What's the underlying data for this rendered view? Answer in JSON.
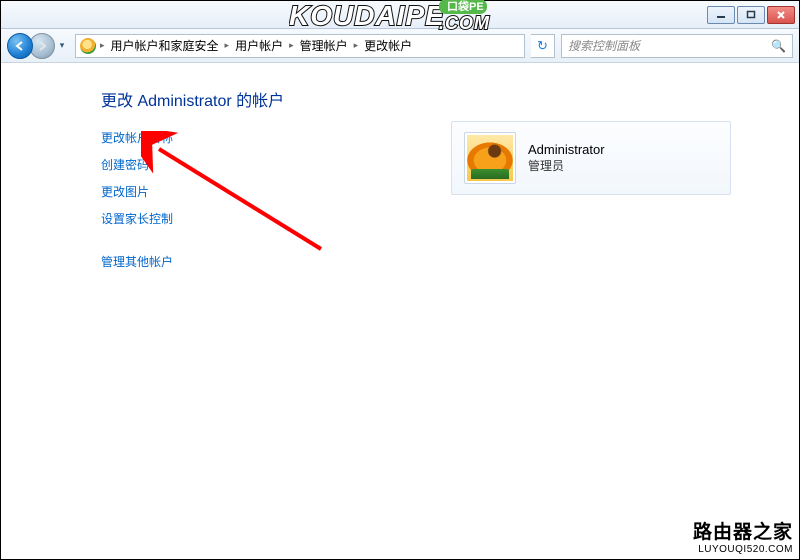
{
  "titlebar": {},
  "nav": {
    "breadcrumb": [
      "用户帐户和家庭安全",
      "用户帐户",
      "管理帐户",
      "更改帐户"
    ],
    "search_placeholder": "搜索控制面板"
  },
  "page": {
    "title": "更改 Administrator 的帐户",
    "links": [
      "更改帐户名称",
      "创建密码",
      "更改图片",
      "设置家长控制",
      "管理其他帐户"
    ]
  },
  "account": {
    "name": "Administrator",
    "role": "管理员"
  },
  "watermark_top": {
    "text": "KOUDAIPE",
    "domain": ".COM",
    "badge": "口袋PE"
  },
  "watermark_bottom": {
    "line1": "路由器之家",
    "line2": "LUYOUQI520.COM"
  }
}
